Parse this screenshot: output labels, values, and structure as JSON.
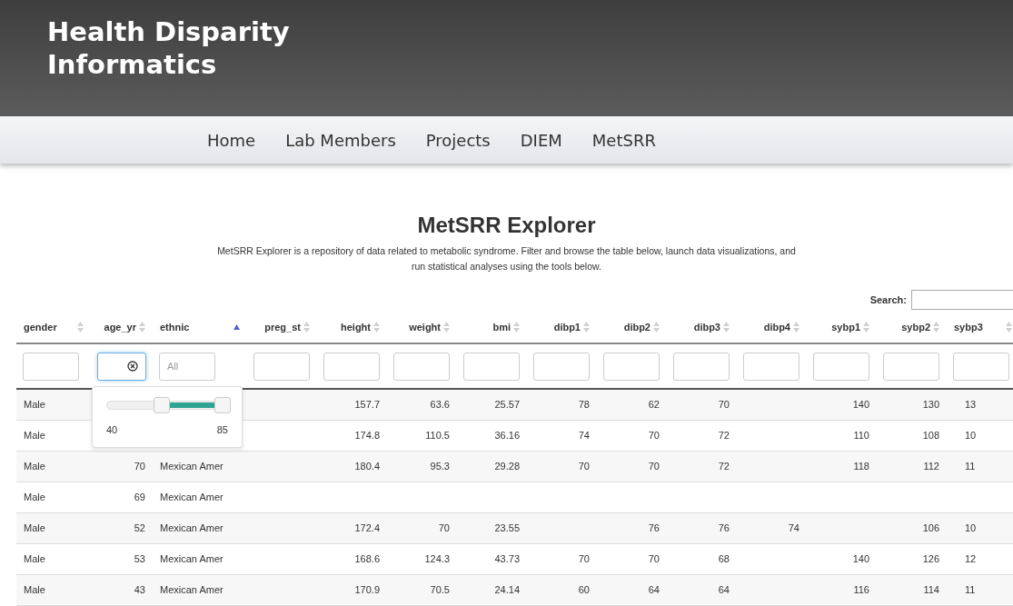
{
  "site": {
    "title_lines": [
      "Health Disparity",
      "Informatics"
    ]
  },
  "nav": [
    {
      "label": "Home"
    },
    {
      "label": "Lab Members"
    },
    {
      "label": "Projects"
    },
    {
      "label": "DIEM"
    },
    {
      "label": "MetSRR"
    }
  ],
  "page": {
    "title": "MetSRR Explorer",
    "description": "MetSRR Explorer is a repository of data related to metabolic syndrome. Filter and browse the table below, launch data visualizations, and run statistical analyses using the tools below."
  },
  "search": {
    "label": "Search:"
  },
  "table": {
    "columns": [
      {
        "label": "gender",
        "sorted": false,
        "filter": {
          "focused": false
        }
      },
      {
        "label": "age_yr",
        "sorted": false,
        "filter": {
          "focused": true,
          "clearable": true,
          "slider": {
            "min_label": "40",
            "max_label": "85",
            "thumbs": [
              {
                "level": 0.45
              },
              {
                "level": 1
              }
            ]
          }
        }
      },
      {
        "label": "ethnic",
        "sorted": true,
        "filter": {
          "focused": false,
          "placeholder": "All"
        }
      },
      {
        "label": "preg_st",
        "sorted": false,
        "filter": {
          "focused": false
        }
      },
      {
        "label": "height",
        "sorted": false,
        "filter": {
          "focused": false
        }
      },
      {
        "label": "weight",
        "sorted": false,
        "filter": {
          "focused": false
        }
      },
      {
        "label": "bmi",
        "sorted": false,
        "filter": {
          "focused": false
        }
      },
      {
        "label": "dibp1",
        "sorted": false,
        "filter": {
          "focused": false
        }
      },
      {
        "label": "dibp2",
        "sorted": false,
        "filter": {
          "focused": false
        }
      },
      {
        "label": "dibp3",
        "sorted": false,
        "filter": {
          "focused": false
        }
      },
      {
        "label": "dibp4",
        "sorted": false,
        "filter": {
          "focused": false
        }
      },
      {
        "label": "sybp1",
        "sorted": false,
        "filter": {
          "focused": false
        }
      },
      {
        "label": "sybp2",
        "sorted": false,
        "filter": {
          "focused": false
        }
      },
      {
        "label": "sybp3",
        "sorted": false,
        "filter": {
          "focused": false
        }
      }
    ],
    "rows": [
      [
        "Male",
        "",
        "",
        "",
        "157.7",
        "63.6",
        "25.57",
        "78",
        "62",
        "70",
        "",
        "140",
        "130",
        "13"
      ],
      [
        "Male",
        "",
        "",
        "",
        "174.8",
        "110.5",
        "36.16",
        "74",
        "70",
        "72",
        "",
        "110",
        "108",
        "10"
      ],
      [
        "Male",
        "70",
        "Mexican Amer",
        "",
        "180.4",
        "95.3",
        "29.28",
        "70",
        "70",
        "72",
        "",
        "118",
        "112",
        "11"
      ],
      [
        "Male",
        "69",
        "Mexican Amer",
        "",
        "",
        "",
        "",
        "",
        "",
        "",
        "",
        "",
        "",
        ""
      ],
      [
        "Male",
        "52",
        "Mexican Amer",
        "",
        "172.4",
        "70",
        "23.55",
        "",
        "76",
        "76",
        "74",
        "",
        "106",
        "10"
      ],
      [
        "Male",
        "53",
        "Mexican Amer",
        "",
        "168.6",
        "124.3",
        "43.73",
        "70",
        "70",
        "68",
        "",
        "140",
        "126",
        "12"
      ],
      [
        "Male",
        "43",
        "Mexican Amer",
        "",
        "170.9",
        "70.5",
        "24.14",
        "60",
        "64",
        "64",
        "",
        "116",
        "114",
        "11"
      ]
    ]
  }
}
